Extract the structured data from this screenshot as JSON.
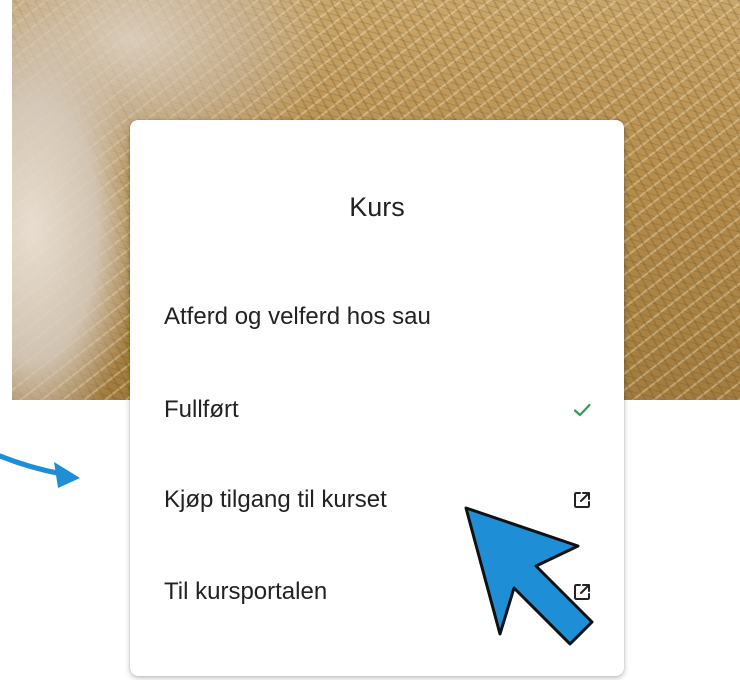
{
  "card": {
    "title": "Kurs",
    "course_name": "Atferd og velferd hos sau",
    "status_label": "Fullført",
    "buy_access_label": "Kjøp tilgang til kurset",
    "portal_label": "Til kursportalen"
  },
  "icons": {
    "status": "check-icon",
    "buy_access": "external-link-icon",
    "portal": "external-link-icon",
    "annotation_small": "arrow-icon",
    "annotation_cursor": "cursor-arrow-icon"
  },
  "colors": {
    "check": "#2e9d57",
    "annotation_blue": "#1e8fd6",
    "text": "#222222"
  }
}
